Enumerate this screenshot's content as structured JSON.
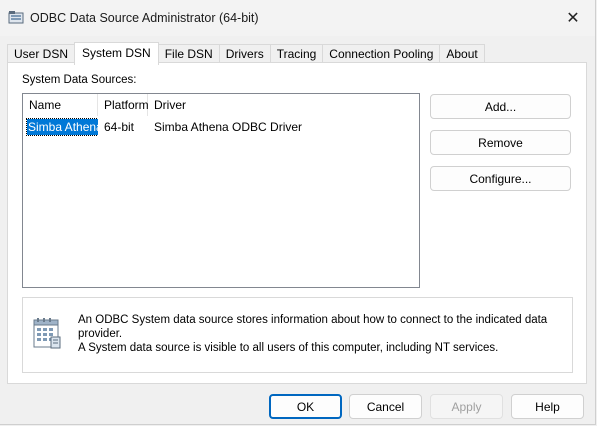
{
  "window": {
    "title": "ODBC Data Source Administrator (64-bit)",
    "close_glyph": "✕"
  },
  "tabs": [
    {
      "label": "User DSN",
      "active": false
    },
    {
      "label": "System DSN",
      "active": true
    },
    {
      "label": "File DSN",
      "active": false
    },
    {
      "label": "Drivers",
      "active": false
    },
    {
      "label": "Tracing",
      "active": false
    },
    {
      "label": "Connection Pooling",
      "active": false
    },
    {
      "label": "About",
      "active": false
    }
  ],
  "panel": {
    "list_label": "System Data Sources:",
    "columns": [
      "Name",
      "Platform",
      "Driver"
    ],
    "rows": [
      {
        "name": "Simba Athena",
        "platform": "64-bit",
        "driver": "Simba Athena ODBC Driver",
        "selected": true
      }
    ],
    "side_buttons": {
      "add": "Add...",
      "remove": "Remove",
      "configure": "Configure..."
    },
    "info": {
      "line1": "An ODBC System data source stores information about how to connect to the indicated data provider.",
      "line2": "A System data source is visible to all users of this computer, including NT services.",
      "icon": "data-source-icon"
    }
  },
  "footer_buttons": {
    "ok": "OK",
    "cancel": "Cancel",
    "apply": "Apply",
    "help": "Help"
  },
  "colors": {
    "selection": "#0078d7",
    "default_button_border": "#0067c0"
  }
}
